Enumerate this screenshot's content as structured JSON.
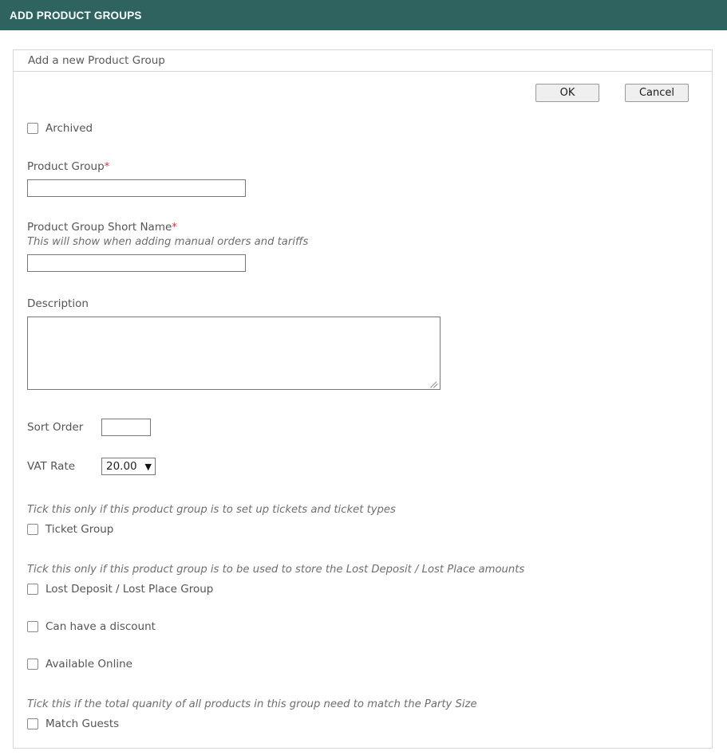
{
  "topbar": {
    "title": "ADD PRODUCT GROUPS"
  },
  "panel": {
    "header_title": "Add a new Product Group"
  },
  "actions": {
    "ok_label": "OK",
    "cancel_label": "Cancel"
  },
  "form": {
    "archived": {
      "label": "Archived",
      "checked": false
    },
    "product_group": {
      "label": "Product Group",
      "required_marker": "*",
      "value": "",
      "placeholder": ""
    },
    "short_name": {
      "label": "Product Group Short Name",
      "required_marker": "*",
      "hint": "This will show when adding manual orders and tariffs",
      "value": "",
      "placeholder": ""
    },
    "description": {
      "label": "Description",
      "value": "",
      "placeholder": ""
    },
    "sort_order": {
      "label": "Sort Order",
      "value": "",
      "placeholder": ""
    },
    "vat_rate": {
      "label": "VAT Rate",
      "selected": "20.00",
      "options": [
        "20.00"
      ]
    },
    "ticket_group": {
      "hint": "Tick this only if this product group is to set up tickets and ticket types",
      "label": "Ticket Group",
      "checked": false
    },
    "lost_deposit_group": {
      "hint": "Tick this only if this product group is to be used to store the Lost Deposit / Lost Place amounts",
      "label": "Lost Deposit / Lost Place Group",
      "checked": false
    },
    "can_have_discount": {
      "label": "Can have a discount",
      "checked": false
    },
    "available_online": {
      "label": "Available Online",
      "checked": false
    },
    "match_guests": {
      "hint": "Tick this if the total quanity of all products in this group need to match the Party Size",
      "label": "Match Guests",
      "checked": false
    }
  },
  "colors": {
    "header_bg": "#2e6360",
    "required_marker": "#c8404a",
    "text": "#555555",
    "border": "#d6d6d6"
  }
}
